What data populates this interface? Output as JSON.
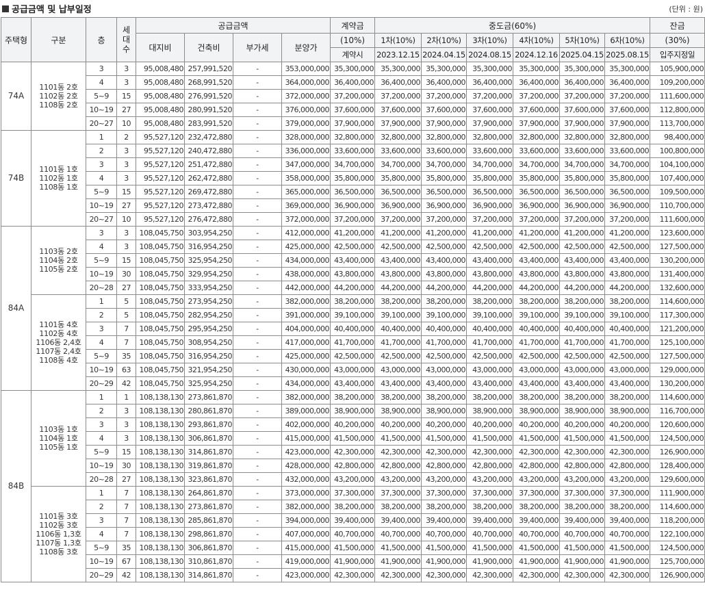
{
  "header": {
    "title": "공급금액 및 납부일정",
    "unit": "(단위 : 원)"
  },
  "columns": {
    "type": "주택형",
    "group": "구분",
    "floor": "층",
    "units": "세\n대\n수",
    "supply": "공급금액",
    "land": "대지비",
    "building": "건축비",
    "vat": "부가세",
    "total": "분양가",
    "deposit_top": "계약금",
    "deposit_pct": "(10%)",
    "deposit_date": "계약시",
    "middle": "중도금(60%)",
    "middle_items": [
      {
        "label": "1차(10%)",
        "date": "2023.12.15"
      },
      {
        "label": "2차(10%)",
        "date": "2024.04.15"
      },
      {
        "label": "3차(10%)",
        "date": "2024.08.15"
      },
      {
        "label": "4차(10%)",
        "date": "2024.12.16"
      },
      {
        "label": "5차(10%)",
        "date": "2025.04.15"
      },
      {
        "label": "6차(10%)",
        "date": "2025.08.15"
      }
    ],
    "balance_top": "잔금",
    "balance_pct": "(30%)",
    "balance_date": "입주지정일"
  },
  "groups": [
    {
      "type": "74A",
      "subgroups": [
        {
          "label": "1101동 2호\n1102동 2호\n1108동 2호",
          "rows": [
            [
              "3",
              "3",
              "95,008,480",
              "257,991,520",
              "-",
              "353,000,000",
              "35,300,000",
              "35,300,000",
              "35,300,000",
              "35,300,000",
              "35,300,000",
              "35,300,000",
              "35,300,000",
              "105,900,000"
            ],
            [
              "4",
              "3",
              "95,008,480",
              "268,991,520",
              "-",
              "364,000,000",
              "36,400,000",
              "36,400,000",
              "36,400,000",
              "36,400,000",
              "36,400,000",
              "36,400,000",
              "36,400,000",
              "109,200,000"
            ],
            [
              "5~9",
              "15",
              "95,008,480",
              "276,991,520",
              "-",
              "372,000,000",
              "37,200,000",
              "37,200,000",
              "37,200,000",
              "37,200,000",
              "37,200,000",
              "37,200,000",
              "37,200,000",
              "111,600,000"
            ],
            [
              "10~19",
              "27",
              "95,008,480",
              "280,991,520",
              "-",
              "376,000,000",
              "37,600,000",
              "37,600,000",
              "37,600,000",
              "37,600,000",
              "37,600,000",
              "37,600,000",
              "37,600,000",
              "112,800,000"
            ],
            [
              "20~27",
              "10",
              "95,008,480",
              "283,991,520",
              "-",
              "379,000,000",
              "37,900,000",
              "37,900,000",
              "37,900,000",
              "37,900,000",
              "37,900,000",
              "37,900,000",
              "37,900,000",
              "113,700,000"
            ]
          ]
        }
      ]
    },
    {
      "type": "74B",
      "subgroups": [
        {
          "label": "1101동 1호\n1102동 1호\n1108동 1호",
          "rows": [
            [
              "1",
              "2",
              "95,527,120",
              "232,472,880",
              "-",
              "328,000,000",
              "32,800,000",
              "32,800,000",
              "32,800,000",
              "32,800,000",
              "32,800,000",
              "32,800,000",
              "32,800,000",
              "98,400,000"
            ],
            [
              "2",
              "3",
              "95,527,120",
              "240,472,880",
              "-",
              "336,000,000",
              "33,600,000",
              "33,600,000",
              "33,600,000",
              "33,600,000",
              "33,600,000",
              "33,600,000",
              "33,600,000",
              "100,800,000"
            ],
            [
              "3",
              "3",
              "95,527,120",
              "251,472,880",
              "-",
              "347,000,000",
              "34,700,000",
              "34,700,000",
              "34,700,000",
              "34,700,000",
              "34,700,000",
              "34,700,000",
              "34,700,000",
              "104,100,000"
            ],
            [
              "4",
              "3",
              "95,527,120",
              "262,472,880",
              "-",
              "358,000,000",
              "35,800,000",
              "35,800,000",
              "35,800,000",
              "35,800,000",
              "35,800,000",
              "35,800,000",
              "35,800,000",
              "107,400,000"
            ],
            [
              "5~9",
              "15",
              "95,527,120",
              "269,472,880",
              "-",
              "365,000,000",
              "36,500,000",
              "36,500,000",
              "36,500,000",
              "36,500,000",
              "36,500,000",
              "36,500,000",
              "36,500,000",
              "109,500,000"
            ],
            [
              "10~19",
              "27",
              "95,527,120",
              "273,472,880",
              "-",
              "369,000,000",
              "36,900,000",
              "36,900,000",
              "36,900,000",
              "36,900,000",
              "36,900,000",
              "36,900,000",
              "36,900,000",
              "110,700,000"
            ],
            [
              "20~27",
              "10",
              "95,527,120",
              "276,472,880",
              "-",
              "372,000,000",
              "37,200,000",
              "37,200,000",
              "37,200,000",
              "37,200,000",
              "37,200,000",
              "37,200,000",
              "37,200,000",
              "111,600,000"
            ]
          ]
        }
      ]
    },
    {
      "type": "84A",
      "subgroups": [
        {
          "label": "1103동 2호\n1104동 2호\n1105동 2호",
          "rows": [
            [
              "3",
              "3",
              "108,045,750",
              "303,954,250",
              "-",
              "412,000,000",
              "41,200,000",
              "41,200,000",
              "41,200,000",
              "41,200,000",
              "41,200,000",
              "41,200,000",
              "41,200,000",
              "123,600,000"
            ],
            [
              "4",
              "3",
              "108,045,750",
              "316,954,250",
              "-",
              "425,000,000",
              "42,500,000",
              "42,500,000",
              "42,500,000",
              "42,500,000",
              "42,500,000",
              "42,500,000",
              "42,500,000",
              "127,500,000"
            ],
            [
              "5~9",
              "15",
              "108,045,750",
              "325,954,250",
              "-",
              "434,000,000",
              "43,400,000",
              "43,400,000",
              "43,400,000",
              "43,400,000",
              "43,400,000",
              "43,400,000",
              "43,400,000",
              "130,200,000"
            ],
            [
              "10~19",
              "30",
              "108,045,750",
              "329,954,250",
              "-",
              "438,000,000",
              "43,800,000",
              "43,800,000",
              "43,800,000",
              "43,800,000",
              "43,800,000",
              "43,800,000",
              "43,800,000",
              "131,400,000"
            ],
            [
              "20~28",
              "27",
              "108,045,750",
              "333,954,250",
              "-",
              "442,000,000",
              "44,200,000",
              "44,200,000",
              "44,200,000",
              "44,200,000",
              "44,200,000",
              "44,200,000",
              "44,200,000",
              "132,600,000"
            ]
          ]
        },
        {
          "label": "1101동 4호\n1102동 4호\n1106동 2,4호\n1107동 2,4호\n1108동 4호",
          "rows": [
            [
              "1",
              "5",
              "108,045,750",
              "273,954,250",
              "-",
              "382,000,000",
              "38,200,000",
              "38,200,000",
              "38,200,000",
              "38,200,000",
              "38,200,000",
              "38,200,000",
              "38,200,000",
              "114,600,000"
            ],
            [
              "2",
              "5",
              "108,045,750",
              "282,954,250",
              "-",
              "391,000,000",
              "39,100,000",
              "39,100,000",
              "39,100,000",
              "39,100,000",
              "39,100,000",
              "39,100,000",
              "39,100,000",
              "117,300,000"
            ],
            [
              "3",
              "7",
              "108,045,750",
              "295,954,250",
              "-",
              "404,000,000",
              "40,400,000",
              "40,400,000",
              "40,400,000",
              "40,400,000",
              "40,400,000",
              "40,400,000",
              "40,400,000",
              "121,200,000"
            ],
            [
              "4",
              "7",
              "108,045,750",
              "308,954,250",
              "-",
              "417,000,000",
              "41,700,000",
              "41,700,000",
              "41,700,000",
              "41,700,000",
              "41,700,000",
              "41,700,000",
              "41,700,000",
              "125,100,000"
            ],
            [
              "5~9",
              "35",
              "108,045,750",
              "316,954,250",
              "-",
              "425,000,000",
              "42,500,000",
              "42,500,000",
              "42,500,000",
              "42,500,000",
              "42,500,000",
              "42,500,000",
              "42,500,000",
              "127,500,000"
            ],
            [
              "10~19",
              "63",
              "108,045,750",
              "321,954,250",
              "-",
              "430,000,000",
              "43,000,000",
              "43,000,000",
              "43,000,000",
              "43,000,000",
              "43,000,000",
              "43,000,000",
              "43,000,000",
              "129,000,000"
            ],
            [
              "20~29",
              "42",
              "108,045,750",
              "325,954,250",
              "-",
              "434,000,000",
              "43,400,000",
              "43,400,000",
              "43,400,000",
              "43,400,000",
              "43,400,000",
              "43,400,000",
              "43,400,000",
              "130,200,000"
            ]
          ]
        }
      ]
    },
    {
      "type": "84B",
      "subgroups": [
        {
          "label": "1103동 1호\n1104동 1호\n1105동 1호",
          "rows": [
            [
              "1",
              "1",
              "108,138,130",
              "273,861,870",
              "-",
              "382,000,000",
              "38,200,000",
              "38,200,000",
              "38,200,000",
              "38,200,000",
              "38,200,000",
              "38,200,000",
              "38,200,000",
              "114,600,000"
            ],
            [
              "2",
              "3",
              "108,138,130",
              "280,861,870",
              "-",
              "389,000,000",
              "38,900,000",
              "38,900,000",
              "38,900,000",
              "38,900,000",
              "38,900,000",
              "38,900,000",
              "38,900,000",
              "116,700,000"
            ],
            [
              "3",
              "3",
              "108,138,130",
              "293,861,870",
              "-",
              "402,000,000",
              "40,200,000",
              "40,200,000",
              "40,200,000",
              "40,200,000",
              "40,200,000",
              "40,200,000",
              "40,200,000",
              "120,600,000"
            ],
            [
              "4",
              "3",
              "108,138,130",
              "306,861,870",
              "-",
              "415,000,000",
              "41,500,000",
              "41,500,000",
              "41,500,000",
              "41,500,000",
              "41,500,000",
              "41,500,000",
              "41,500,000",
              "124,500,000"
            ],
            [
              "5~9",
              "15",
              "108,138,130",
              "314,861,870",
              "-",
              "423,000,000",
              "42,300,000",
              "42,300,000",
              "42,300,000",
              "42,300,000",
              "42,300,000",
              "42,300,000",
              "42,300,000",
              "126,900,000"
            ],
            [
              "10~19",
              "30",
              "108,138,130",
              "319,861,870",
              "-",
              "428,000,000",
              "42,800,000",
              "42,800,000",
              "42,800,000",
              "42,800,000",
              "42,800,000",
              "42,800,000",
              "42,800,000",
              "128,400,000"
            ],
            [
              "20~28",
              "27",
              "108,138,130",
              "323,861,870",
              "-",
              "432,000,000",
              "43,200,000",
              "43,200,000",
              "43,200,000",
              "43,200,000",
              "43,200,000",
              "43,200,000",
              "43,200,000",
              "129,600,000"
            ]
          ]
        },
        {
          "label": "1101동 3호\n1102동 3호\n1106동 1,3호\n1107동 1,3호\n1108동 3호",
          "rows": [
            [
              "1",
              "7",
              "108,138,130",
              "264,861,870",
              "-",
              "373,000,000",
              "37,300,000",
              "37,300,000",
              "37,300,000",
              "37,300,000",
              "37,300,000",
              "37,300,000",
              "37,300,000",
              "111,900,000"
            ],
            [
              "2",
              "7",
              "108,138,130",
              "273,861,870",
              "-",
              "382,000,000",
              "38,200,000",
              "38,200,000",
              "38,200,000",
              "38,200,000",
              "38,200,000",
              "38,200,000",
              "38,200,000",
              "114,600,000"
            ],
            [
              "3",
              "7",
              "108,138,130",
              "285,861,870",
              "-",
              "394,000,000",
              "39,400,000",
              "39,400,000",
              "39,400,000",
              "39,400,000",
              "39,400,000",
              "39,400,000",
              "39,400,000",
              "118,200,000"
            ],
            [
              "4",
              "7",
              "108,138,130",
              "298,861,870",
              "-",
              "407,000,000",
              "40,700,000",
              "40,700,000",
              "40,700,000",
              "40,700,000",
              "40,700,000",
              "40,700,000",
              "40,700,000",
              "122,100,000"
            ],
            [
              "5~9",
              "35",
              "108,138,130",
              "306,861,870",
              "-",
              "415,000,000",
              "41,500,000",
              "41,500,000",
              "41,500,000",
              "41,500,000",
              "41,500,000",
              "41,500,000",
              "41,500,000",
              "124,500,000"
            ],
            [
              "10~19",
              "67",
              "108,138,130",
              "310,861,870",
              "-",
              "419,000,000",
              "41,900,000",
              "41,900,000",
              "41,900,000",
              "41,900,000",
              "41,900,000",
              "41,900,000",
              "41,900,000",
              "125,700,000"
            ],
            [
              "20~29",
              "42",
              "108,138,130",
              "314,861,870",
              "-",
              "423,000,000",
              "42,300,000",
              "42,300,000",
              "42,300,000",
              "42,300,000",
              "42,300,000",
              "42,300,000",
              "42,300,000",
              "126,900,000"
            ]
          ]
        }
      ]
    }
  ]
}
